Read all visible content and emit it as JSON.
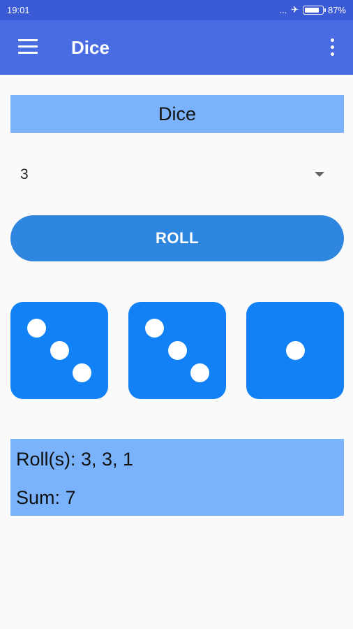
{
  "status_bar": {
    "time": "19:01",
    "dots": "...",
    "battery": "87%"
  },
  "app_bar": {
    "title": "Dice"
  },
  "header": {
    "text": "Dice"
  },
  "dice_count": {
    "selected": "3"
  },
  "roll_button": {
    "label": "ROLL"
  },
  "dice": [
    3,
    3,
    1
  ],
  "results": {
    "rolls": "Roll(s): 3, 3, 1",
    "sum": "Sum: 7"
  },
  "colors": {
    "status_bar": "#3a5ad6",
    "app_bar": "#4a6ce3",
    "panel": "#7ab3fb",
    "button": "#2f86df",
    "die": "#1181f5"
  }
}
